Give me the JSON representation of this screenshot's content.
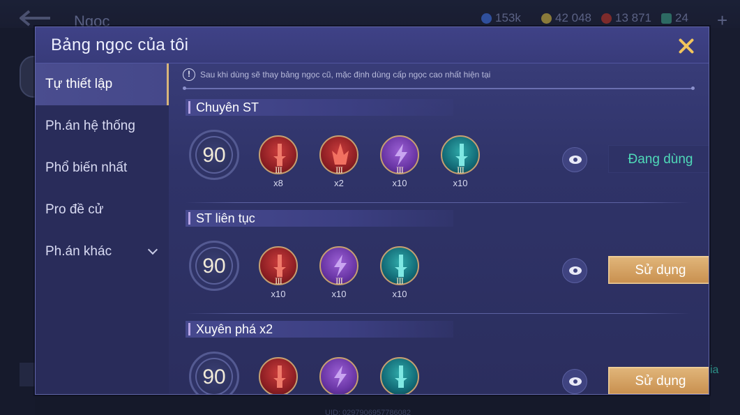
{
  "background": {
    "title": "Ngọc",
    "currencies": [
      {
        "icon": "blue-gem-coin-icon",
        "value": "153k",
        "color": "#3b6ccf"
      },
      {
        "icon": "gold-coin-icon",
        "value": "42 048",
        "color": "#c9a23b"
      },
      {
        "icon": "red-gem-icon",
        "value": "13 871",
        "color": "#c0392b"
      },
      {
        "icon": "ticket-icon",
        "value": "24",
        "color": "#3aa38f"
      }
    ],
    "plus_label": "+",
    "right_hint": "ia",
    "footer_id": "UID: 0297906957786082"
  },
  "modal": {
    "title": "Bảng ngọc của tôi",
    "notice": "Sau khi dùng sẽ thay bảng ngọc cũ, mặc định dùng cấp ngọc cao nhất hiện tại"
  },
  "sidebar": {
    "items": [
      {
        "label": "Tự thiết lập",
        "active": true
      },
      {
        "label": "Ph.án hệ thống",
        "active": false
      },
      {
        "label": "Phổ biến nhất",
        "active": false
      },
      {
        "label": "Pro đề cử",
        "active": false
      },
      {
        "label": "Ph.án khác",
        "active": false,
        "expandable": true
      }
    ]
  },
  "setups": [
    {
      "name": "Chuyên ST",
      "level": "90",
      "gems": [
        {
          "color": "red",
          "shape": "sword",
          "tier": "III",
          "count": "x8"
        },
        {
          "color": "red",
          "shape": "spike",
          "tier": "III",
          "count": "x2"
        },
        {
          "color": "purple",
          "shape": "bolt",
          "tier": "III",
          "count": "x10"
        },
        {
          "color": "teal",
          "shape": "sword",
          "tier": "III",
          "count": "x10"
        }
      ],
      "button": {
        "label": "Đang dùng",
        "state": "in-use"
      }
    },
    {
      "name": "ST liên tục",
      "level": "90",
      "gems": [
        {
          "color": "red",
          "shape": "sword",
          "tier": "III",
          "count": "x10"
        },
        {
          "color": "purple",
          "shape": "bolt",
          "tier": "III",
          "count": "x10"
        },
        {
          "color": "teal",
          "shape": "sword",
          "tier": "III",
          "count": "x10"
        }
      ],
      "button": {
        "label": "Sử dụng",
        "state": "use"
      }
    },
    {
      "name": "Xuyên phá x2",
      "level": "90",
      "gems": [
        {
          "color": "red",
          "shape": "sword",
          "tier": "III",
          "count": ""
        },
        {
          "color": "purple",
          "shape": "bolt",
          "tier": "III",
          "count": ""
        },
        {
          "color": "teal",
          "shape": "sword",
          "tier": "III",
          "count": ""
        }
      ],
      "button": {
        "label": "Sử dụng",
        "state": "use"
      }
    }
  ]
}
